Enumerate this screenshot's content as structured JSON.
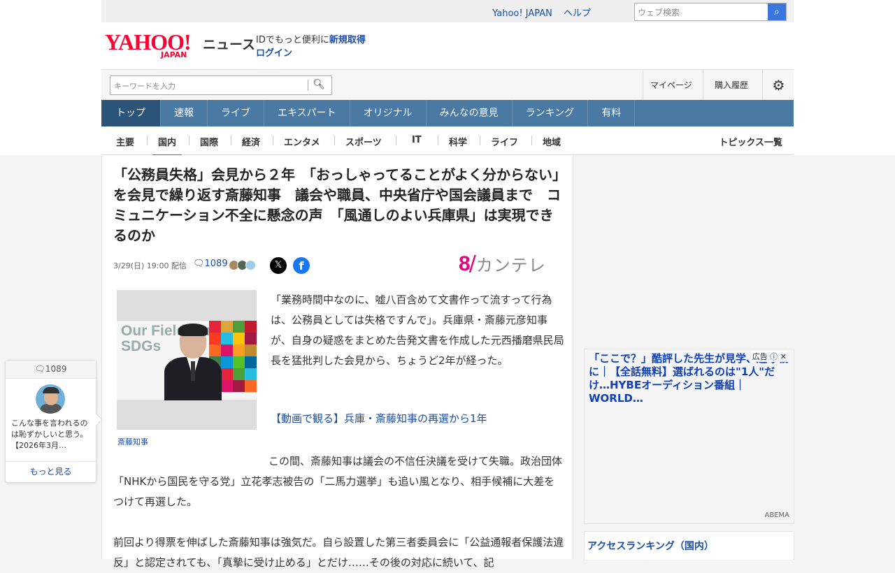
{
  "util": {
    "yahoo_link": "Yahoo! JAPAN",
    "help_link": "ヘルプ",
    "search_placeholder": "ウェブ検索"
  },
  "brand": {
    "logo_text": "YAHOO!",
    "logo_sub": "JAPAN",
    "section": "ニュース",
    "id_prompt": "IDでもっと便利に",
    "register_link": "新規取得",
    "login_link": "ログイン"
  },
  "search": {
    "placeholder": "キーワードを入力",
    "mypage": "マイページ",
    "purchase_history": "購入履歴"
  },
  "main_nav": [
    "トップ",
    "速報",
    "ライブ",
    "エキスパート",
    "オリジナル",
    "みんなの意見",
    "ランキング",
    "有料"
  ],
  "sub_nav": [
    "主要",
    "国内",
    "国際",
    "経済",
    "エンタメ",
    "スポーツ",
    "IT",
    "科学",
    "ライフ",
    "地域"
  ],
  "topics_link": "トピックス一覧",
  "article": {
    "title": "「公務員失格」会見から２年　「おっしゃってることがよく分からない」を会見で繰り返す斎藤知事　議会や職員、中央省庁や国会議員まで　コミュニケーション不全に懸念の声　「風通しのよい兵庫県」は実現できるのか",
    "datetime": "3/29(日) 19:00",
    "delivery": "配信",
    "comment_count": "1089",
    "source_logo_num": "8",
    "source_logo_text": "カンテレ",
    "photo_banner_text": "Our Field Our SDGs",
    "photo_caption": "斎藤知事",
    "p1": "「業務時間中なのに、嘘八百含めて文書作って流すって行為は、公務員としては失格ですんで」。兵庫県・斎藤元彦知事が、自身の疑惑をまとめた告発文書を作成した元西播磨県民局長を猛批判した会見から、ちょうど2年が経った。",
    "video_link": "【動画で観る】兵庫・斎藤知事の再選から1年",
    "p2": "この間、斎藤知事は議会の不信任決議を受けて失職。政治団体「NHKから国民を守る党」立花孝志被告の「二馬力選挙」も追い風となり、相手候補に大差をつけて再選した。",
    "p3": "前回より得票を伸ばした斎藤知事は強気だ。自ら設置した第三者委員会に「公益通報者保護法違反」と認定されても、「真摯に受け止める」とだけ……その後の対応に続いて、記"
  },
  "ad": {
    "label": "広告",
    "title": "「ここで？」酷評した先生が見学、過呼吸に｜【全話無料】選ばれるのは\"1人\"だけ…HYBEオーディション番組｜WORLD…",
    "source": "ABEMA"
  },
  "ranking_title": "アクセスランキング（国内）",
  "float_comment": {
    "count": "1089",
    "text": "こんな事を言われるのは恥ずかしいと思う。【2026年3月…",
    "more": "もっと見る"
  },
  "colors": {
    "brand_red": "#ff0033",
    "nav_blue": "#4a7aa3",
    "link_blue": "#1a4ea8",
    "kantele_pink": "#e4007f"
  }
}
